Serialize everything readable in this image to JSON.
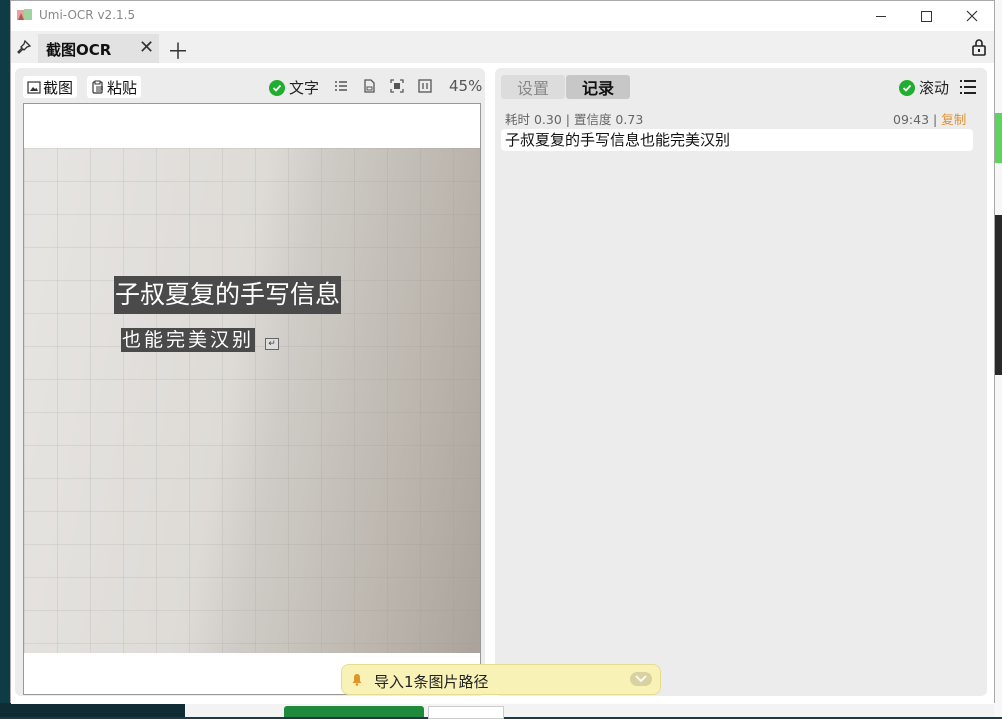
{
  "window": {
    "title": "Umi-OCR v2.1.5"
  },
  "tabs": [
    {
      "label": "截图OCR",
      "active": true
    }
  ],
  "left_toolbar": {
    "screenshot_label": "截图",
    "paste_label": "粘贴",
    "text_toggle_label": "文字",
    "text_toggle_checked": true,
    "zoom": "45%"
  },
  "preview": {
    "ocr_line1": "子叔夏复的手写信息",
    "ocr_line2": "也能完美汉别"
  },
  "right_tabs": {
    "settings_label": "设置",
    "records_label": "记录"
  },
  "right_toolbar": {
    "scroll_label": "滚动",
    "scroll_checked": true
  },
  "record": {
    "meta": "耗时 0.30 | 置信度 0.73",
    "time": "09:43",
    "separator": "|",
    "copy_label": "复制",
    "text": "子叔夏复的手写信息也能完美汉别"
  },
  "toast": {
    "message": "导入1条图片路径"
  },
  "colors": {
    "check_green": "#1fae2f",
    "copy_orange": "#e09030",
    "toast_bg": "#f8f2b7"
  }
}
